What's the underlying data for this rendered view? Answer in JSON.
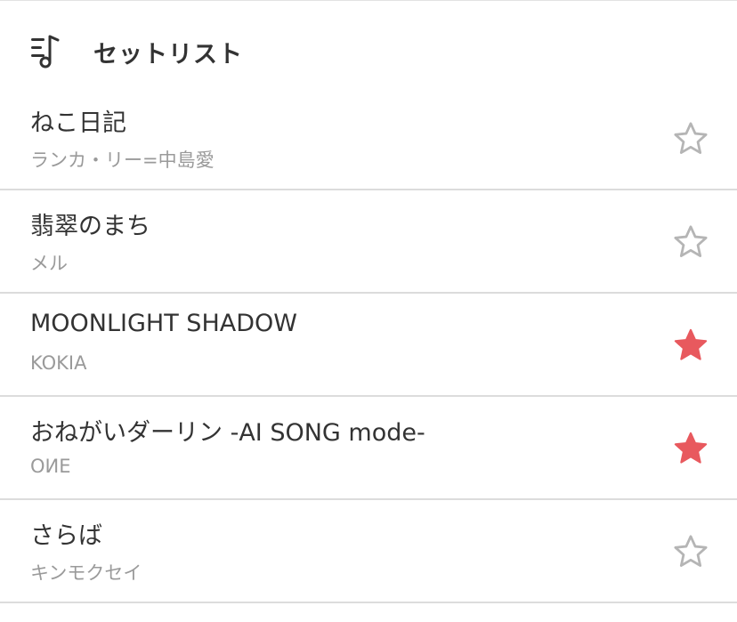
{
  "header": {
    "title": "セットリスト",
    "icon": "playlist-icon"
  },
  "songs": [
    {
      "title": "ねこ日記",
      "artist": "ランカ・リー=中島愛",
      "favorite": false
    },
    {
      "title": "翡翠のまち",
      "artist": "メル",
      "favorite": false
    },
    {
      "title": "MOONLIGHT SHADOW",
      "artist": "KOKIA",
      "favorite": true
    },
    {
      "title": "おねがいダーリン -AI SONG mode-",
      "artist": "OИE",
      "favorite": true
    },
    {
      "title": "さらば",
      "artist": "キンモクセイ",
      "favorite": false
    }
  ],
  "colors": {
    "star_active": "#e8595e",
    "star_inactive": "#b5b5b5",
    "divider": "#dcdcdc"
  }
}
